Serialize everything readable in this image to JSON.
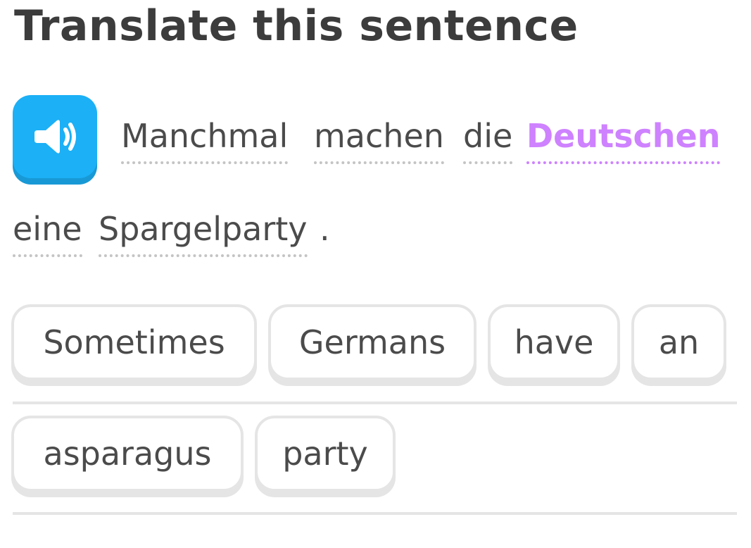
{
  "challenge": {
    "title": "Translate this sentence"
  },
  "prompt": {
    "speaker_icon": "speaker-icon",
    "words": [
      {
        "text": "Manchmal"
      },
      {
        "text": "machen"
      },
      {
        "text": "die"
      },
      {
        "text": "Deutschen",
        "highlighted": true
      },
      {
        "text": "eine"
      },
      {
        "text": "Spargelparty"
      }
    ],
    "punctuation": ".",
    "highlight_color": "#ce82ff"
  },
  "answer": {
    "tiles": [
      "Sometimes",
      "Germans",
      "have",
      "an",
      "asparagus",
      "party"
    ]
  },
  "colors": {
    "speaker_button": "#1cb0f6",
    "tile_border": "#e5e5e5",
    "text": "#4b4b4b"
  }
}
